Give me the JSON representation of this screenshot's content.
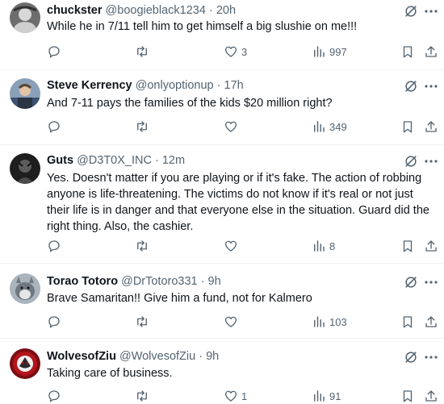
{
  "replies": [
    {
      "name": "chuckster",
      "handle": "@boogieblack1234",
      "time": "20h",
      "text": "While he in 7/11 tell him to get himself a big slushie on me!!!",
      "likes": "3",
      "views": "997"
    },
    {
      "name": "Steve Kerrency",
      "handle": "@onlyoptionup",
      "time": "17h",
      "text": "And 7-11 pays the families of the kids $20 million right?",
      "likes": "",
      "views": "349"
    },
    {
      "name": "Guts",
      "handle": "@D3T0X_INC",
      "time": "12m",
      "text": "Yes. Doesn't matter if you are playing or if it's fake. The action of robbing anyone is life-threatening. The victims do not know if it's real or not just their life is in danger and that everyone else in the situation. Guard did the right thing. Also, the cashier.",
      "likes": "",
      "views": "8"
    },
    {
      "name": "Torao Totoro",
      "handle": "@DrTotoro331",
      "time": "9h",
      "text": "Brave Samaritan!! Give him a fund, not for Kalmero",
      "likes": "",
      "views": "103"
    },
    {
      "name": "WolvesofZiu",
      "handle": "@WolvesofZiu",
      "time": "9h",
      "text": "Taking care of business.",
      "likes": "1",
      "views": "91"
    }
  ],
  "separator": "·",
  "colors": {
    "text": "#0f1419",
    "secondary": "#536471",
    "divider": "#eff3f4"
  }
}
